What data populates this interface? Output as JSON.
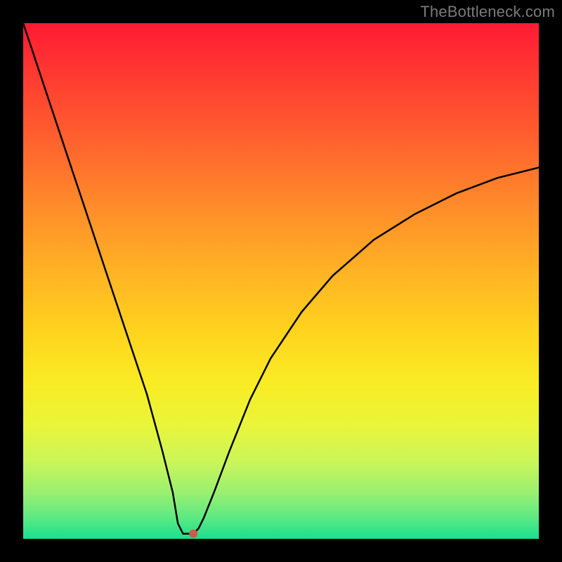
{
  "watermark": "TheBottleneck.com",
  "chart_data": {
    "type": "line",
    "title": "",
    "xlabel": "",
    "ylabel": "",
    "xlim": [
      0,
      100
    ],
    "ylim": [
      0,
      100
    ],
    "x": [
      0,
      2,
      5,
      8,
      12,
      16,
      20,
      24,
      27,
      29,
      30,
      31,
      32,
      33,
      34,
      35,
      37,
      40,
      44,
      48,
      54,
      60,
      68,
      76,
      84,
      92,
      100
    ],
    "values": [
      100,
      94,
      85,
      76,
      64,
      52,
      40,
      28,
      17,
      9,
      3,
      1,
      1,
      1,
      2,
      4,
      9,
      17,
      27,
      35,
      44,
      51,
      58,
      63,
      67,
      70,
      72
    ],
    "marker": {
      "x": 33,
      "y": 1,
      "color": "#d05a4a"
    },
    "gradient_colors": [
      "#ff1a33",
      "#ffd41e",
      "#18e08f"
    ]
  }
}
